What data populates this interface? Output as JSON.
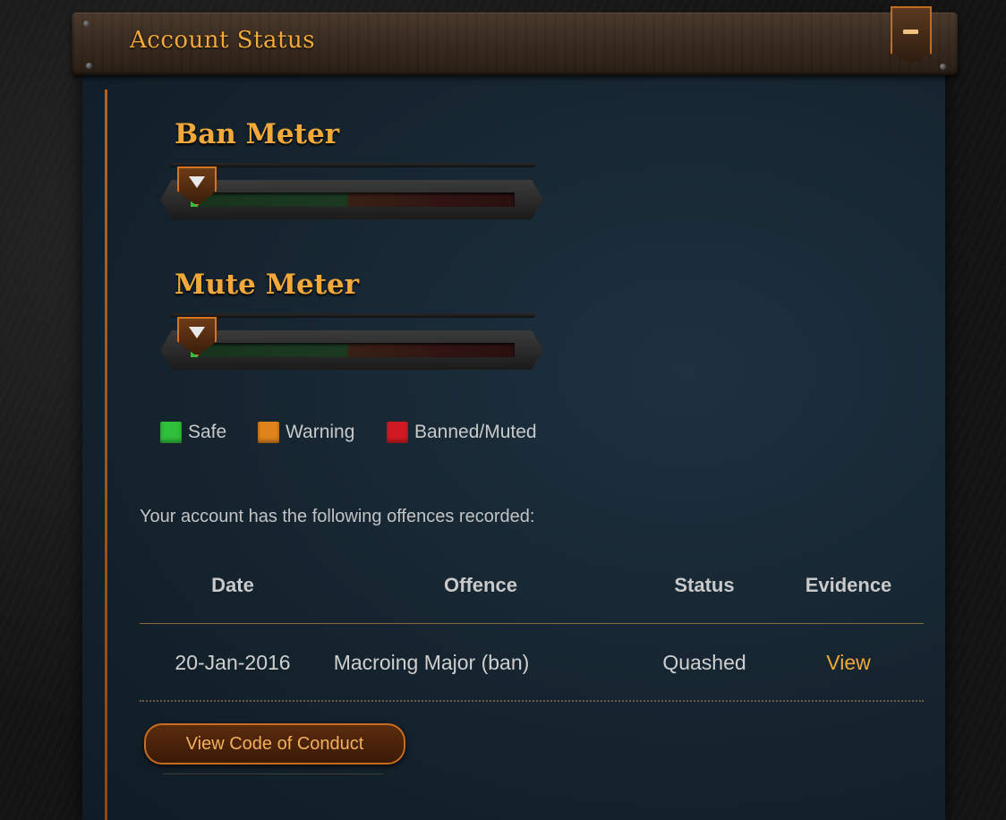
{
  "header": {
    "title": "Account Status",
    "collapse_icon": "minus-icon"
  },
  "meters": [
    {
      "title": "Ban Meter",
      "level": 0.02
    },
    {
      "title": "Mute Meter",
      "level": 0.02
    }
  ],
  "legend": [
    {
      "label": "Safe",
      "color": "#2fbf3a"
    },
    {
      "label": "Warning",
      "color": "#e0851c"
    },
    {
      "label": "Banned/Muted",
      "color": "#d11a23"
    }
  ],
  "offences": {
    "intro": "Your account has the following offences recorded:",
    "columns": [
      "Date",
      "Offence",
      "Status",
      "Evidence"
    ],
    "rows": [
      {
        "date": "20-Jan-2016",
        "offence": "Macroing Major (ban)",
        "status": "Quashed",
        "evidence": "View"
      }
    ]
  },
  "actions": {
    "code_of_conduct": "View Code of Conduct"
  },
  "colors": {
    "accent": "#f2a93a",
    "rail": "#b5621d"
  }
}
